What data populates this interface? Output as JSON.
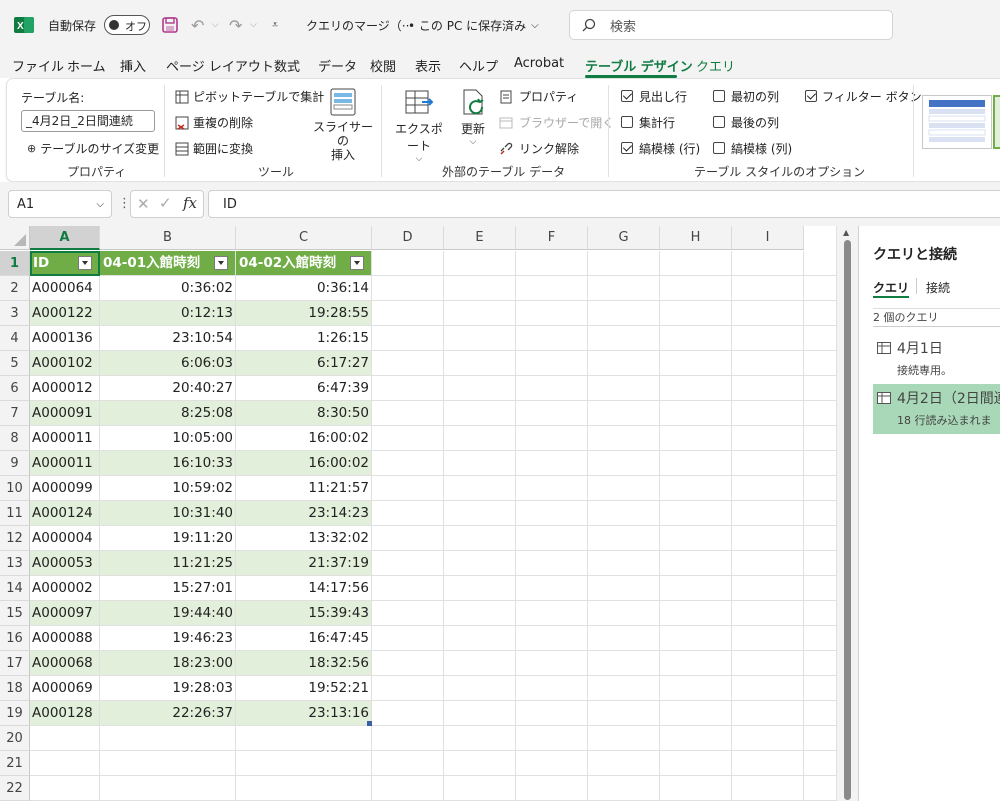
{
  "titlebar": {
    "autosave_label": "自動保存",
    "autosave_state": "オフ",
    "filename": "クエリのマージ（···",
    "save_status": "• この PC に保存済み",
    "search_placeholder": "検索"
  },
  "menu": {
    "tabs": [
      "ファイル",
      "ホーム",
      "挿入",
      "ページ レイアウト",
      "数式",
      "データ",
      "校閲",
      "表示",
      "ヘルプ",
      "Acrobat",
      "テーブル デザイン",
      "クエリ"
    ],
    "active": "テーブル デザイン"
  },
  "ribbon": {
    "properties": {
      "name_label": "テーブル名:",
      "name_value": "_4月2日_2日間連続",
      "resize": "テーブルのサイズ変更",
      "group": "プロパティ"
    },
    "tools": {
      "pivot": "ピボットテーブルで集計",
      "dedupe": "重複の削除",
      "convert": "範囲に変換",
      "slicer_line1": "スライサーの",
      "slicer_line2": "挿入",
      "group": "ツール"
    },
    "external": {
      "export": "エクスポート",
      "refresh": "更新",
      "properties": "プロパティ",
      "browser": "ブラウザーで開く",
      "unlink": "リンク解除",
      "group": "外部のテーブル データ"
    },
    "style_options": {
      "header_row": {
        "label": "見出し行",
        "checked": true
      },
      "total_row": {
        "label": "集計行",
        "checked": false
      },
      "banded_rows": {
        "label": "縞模様 (行)",
        "checked": true
      },
      "first_column": {
        "label": "最初の列",
        "checked": false
      },
      "last_column": {
        "label": "最後の列",
        "checked": false
      },
      "banded_columns": {
        "label": "縞模様 (列)",
        "checked": false
      },
      "filter_button": {
        "label": "フィルター ボタン",
        "checked": true
      },
      "group": "テーブル スタイルのオプション"
    }
  },
  "formula_bar": {
    "name_box": "A1",
    "fx": "fx",
    "content": "ID"
  },
  "grid": {
    "columns": [
      "A",
      "B",
      "C",
      "D",
      "E",
      "F",
      "G",
      "H",
      "I"
    ],
    "row_numbers": [
      "1",
      "2",
      "3",
      "4",
      "5",
      "6",
      "7",
      "8",
      "9",
      "10",
      "11",
      "12",
      "13",
      "14",
      "15",
      "16",
      "17",
      "18",
      "19",
      "20",
      "21",
      "22"
    ],
    "headers": [
      "ID",
      "04-01入館時刻",
      "04-02入館時刻"
    ],
    "rows": [
      [
        "A000064",
        "0:36:02",
        "0:36:14"
      ],
      [
        "A000122",
        "0:12:13",
        "19:28:55"
      ],
      [
        "A000136",
        "23:10:54",
        "1:26:15"
      ],
      [
        "A000102",
        "6:06:03",
        "6:17:27"
      ],
      [
        "A000012",
        "20:40:27",
        "6:47:39"
      ],
      [
        "A000091",
        "8:25:08",
        "8:30:50"
      ],
      [
        "A000011",
        "10:05:00",
        "16:00:02"
      ],
      [
        "A000011",
        "16:10:33",
        "16:00:02"
      ],
      [
        "A000099",
        "10:59:02",
        "11:21:57"
      ],
      [
        "A000124",
        "10:31:40",
        "23:14:23"
      ],
      [
        "A000004",
        "19:11:20",
        "13:32:02"
      ],
      [
        "A000053",
        "11:21:25",
        "21:37:19"
      ],
      [
        "A000002",
        "15:27:01",
        "14:17:56"
      ],
      [
        "A000097",
        "19:44:40",
        "15:39:43"
      ],
      [
        "A000088",
        "19:46:23",
        "16:47:45"
      ],
      [
        "A000068",
        "18:23:00",
        "18:32:56"
      ],
      [
        "A000069",
        "19:28:03",
        "19:52:21"
      ],
      [
        "A000128",
        "22:26:37",
        "23:13:16"
      ]
    ]
  },
  "queries_panel": {
    "title": "クエリと接続",
    "tab_queries": "クエリ",
    "tab_connections": "接続",
    "count": "2 個のクエリ",
    "items": [
      {
        "name": "4月1日",
        "status": "接続専用。"
      },
      {
        "name": "4月2日（2日間連",
        "status": "18 行読み込まれま"
      }
    ]
  },
  "colors": {
    "accent": "#107c41",
    "table_header": "#70ad47",
    "band": "#e2efda"
  }
}
